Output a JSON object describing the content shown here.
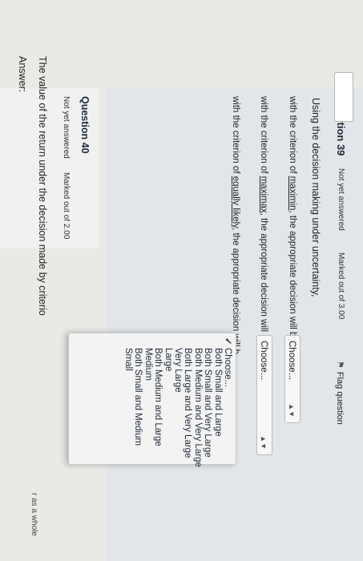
{
  "q39": {
    "title": "Question 39",
    "status": "Not yet answered",
    "marked": "Marked out of 3.00",
    "flag": "Flag question",
    "intro": "Using the decision making under uncertainty,",
    "line1_pre": "with the criterion of ",
    "line1_link": "maximin",
    "line1_post": ", the appropriate decision will be",
    "line2_pre": "with the criterion of ",
    "line2_link": "maximax",
    "line2_post": ", the appropriate decision will be",
    "line3_pre": "with the criterion of ",
    "line3_link": "equally likely",
    "line3_post": ", the appropriate decision will b",
    "select1": "Choose...",
    "select2": "Choose..."
  },
  "dropdown": {
    "options": [
      "Choose...",
      "Both Small and Large",
      "Both Small and Very Large",
      "Both Medium and Very Large",
      "Both Large and Very Large",
      "Very Large",
      "Large",
      "Both Medium and Large",
      "Medium",
      "Both Small and Medium",
      "Small"
    ]
  },
  "q40": {
    "title": "Question 40",
    "status": "Not yet answered",
    "marked": "Marked out of 2.00",
    "text": "The value of the return under the decision made by criterio",
    "answer_label": "Answer:"
  },
  "edge_text": "r as a whole"
}
